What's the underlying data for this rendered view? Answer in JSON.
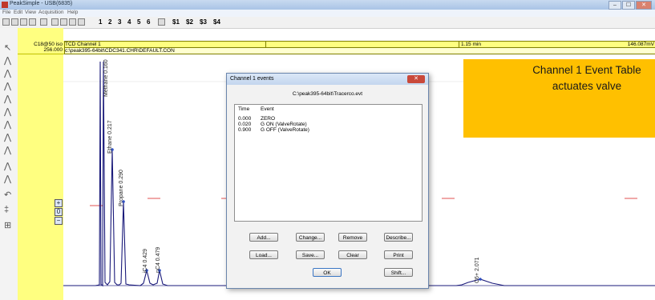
{
  "window": {
    "title": "PeakSimple - USB(6835)",
    "controls": [
      "–",
      "☐",
      "✕"
    ]
  },
  "menu": [
    "File",
    "Edit",
    "View",
    "Acquisition",
    "Help"
  ],
  "toolbar": {
    "channels": [
      "1",
      "2",
      "3",
      "4",
      "5",
      "6"
    ],
    "sets": [
      "$1",
      "$2",
      "$3",
      "$4"
    ]
  },
  "header": {
    "method": "C18@50 iso",
    "channel": "TCD Channel 1",
    "scale": "256.000",
    "path": "c:\\peak395-64bit\\CDC341.CHR\\DEFAULT.CON",
    "time": "1.15 min",
    "signal": "146.087mV"
  },
  "peaks": [
    {
      "label": "Methane 0.160",
      "time": 0.16
    },
    {
      "label": "Ethane 0.217",
      "time": 0.217
    },
    {
      "label": "Propane 0.290",
      "time": 0.29
    },
    {
      "label": "iC4 0.429",
      "time": 0.429
    },
    {
      "label": "nC4 0.479",
      "time": 0.479
    },
    {
      "label": "C6+ 2.071",
      "time": 2.071
    }
  ],
  "dialog": {
    "title": "Channel 1 events",
    "close": "✕",
    "file_path": "C:\\peak395-64bit\\Tracerco.evt",
    "col_time": "Time",
    "col_event": "Event",
    "events": [
      {
        "time": "0.000",
        "event": "ZERO"
      },
      {
        "time": "0.020",
        "event": "G ON (ValveRotate)"
      },
      {
        "time": "0.900",
        "event": "G OFF (ValveRotate)"
      }
    ],
    "buttons": {
      "add": "Add...",
      "change": "Change...",
      "remove": "Remove",
      "describe": "Describe...",
      "load": "Load...",
      "save": "Save...",
      "clear": "Clear",
      "print": "Print",
      "ok": "OK",
      "shift": "Shift..."
    }
  },
  "callout": {
    "text": "Channel 1 Event Table\nactuates valve"
  }
}
